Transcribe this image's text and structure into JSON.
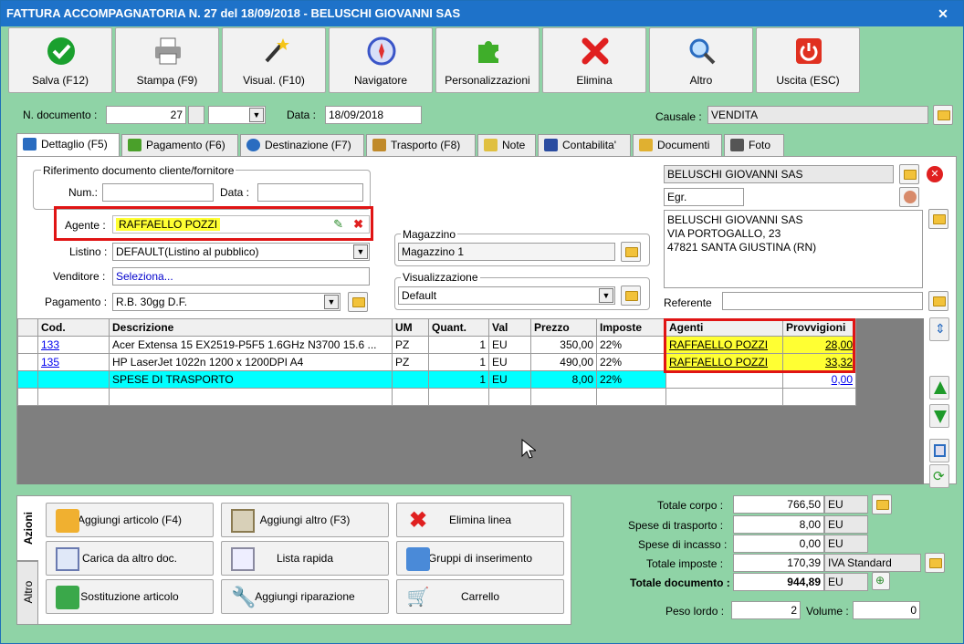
{
  "window": {
    "title": "FATTURA ACCOMPAGNATORIA N. 27 del 18/09/2018 - BELUSCHI GIOVANNI SAS"
  },
  "toolbar": [
    {
      "label": "Salva (F12)",
      "icon": "check-icon",
      "color": "#1aa02e"
    },
    {
      "label": "Stampa (F9)",
      "icon": "printer-icon",
      "color": "#8a8a8a"
    },
    {
      "label": "Visual. (F10)",
      "icon": "magic-wand-icon",
      "color": "#333333"
    },
    {
      "label": "Navigatore",
      "icon": "compass-icon",
      "color": "#3a55c8"
    },
    {
      "label": "Personalizzazioni",
      "icon": "puzzle-icon",
      "color": "#3fae2a"
    },
    {
      "label": "Elimina",
      "icon": "red-x-icon",
      "color": "#e02020"
    },
    {
      "label": "Altro",
      "icon": "magnifier-icon",
      "color": "#2a6cc0"
    },
    {
      "label": "Uscita (ESC)",
      "icon": "power-icon",
      "color": "#e03020"
    }
  ],
  "header": {
    "doc_label": "N. documento :",
    "doc_number": "27",
    "date_label": "Data :",
    "date": "18/09/2018",
    "causale_label": "Causale :",
    "causale": "VENDITA"
  },
  "tabs": [
    {
      "label": "Dettaglio (F5)",
      "color": "#2a6cc0"
    },
    {
      "label": "Pagamento (F6)",
      "color": "#4aa02a"
    },
    {
      "label": "Destinazione (F7)",
      "color": "#2a6cc0"
    },
    {
      "label": "Trasporto (F8)",
      "color": "#c08a2a"
    },
    {
      "label": "Note",
      "color": "#e0c040"
    },
    {
      "label": "Contabilita'",
      "color": "#2a4ca0"
    },
    {
      "label": "Documenti",
      "color": "#e0b030"
    },
    {
      "label": "Foto",
      "color": "#555555"
    }
  ],
  "riferimento": {
    "title": "Riferimento documento cliente/fornitore",
    "num_label": "Num.:",
    "data_label": "Data :"
  },
  "form": {
    "agente_label": "Agente :",
    "agente": "RAFFAELLO POZZI",
    "listino_label": "Listino :",
    "listino": "DEFAULT(Listino al pubblico)",
    "venditore_label": "Venditore :",
    "venditore": "Seleziona...",
    "pagamento_label": "Pagamento :",
    "pagamento": "R.B. 30gg D.F.",
    "magazzino_title": "Magazzino",
    "magazzino": "Magazzino 1",
    "visual_title": "Visualizzazione",
    "visual": "Default"
  },
  "cliente": {
    "name": "BELUSCHI GIOVANNI SAS",
    "title": "Egr.",
    "address": [
      "BELUSCHI GIOVANNI SAS",
      "VIA PORTOGALLO, 23",
      "47821 SANTA GIUSTINA (RN)"
    ],
    "referente_label": "Referente"
  },
  "grid": {
    "headers": [
      "Cod.",
      "Descrizione",
      "UM",
      "Quant.",
      "Val",
      "Prezzo",
      "Imposte",
      "Agenti",
      "Provvigioni"
    ],
    "rows": [
      {
        "cod": "133",
        "desc": "Acer Extensa 15 EX2519-P5F5 1.6GHz N3700 15.6 ...",
        "um": "PZ",
        "qty": "1",
        "val": "EU",
        "price": "350,00",
        "tax": "22%",
        "agent": "RAFFAELLO POZZI",
        "comm": "28,00"
      },
      {
        "cod": "135",
        "desc": "HP LaserJet 1022n 1200 x 1200DPI A4",
        "um": "PZ",
        "qty": "1",
        "val": "EU",
        "price": "490,00",
        "tax": "22%",
        "agent": "RAFFAELLO POZZI",
        "comm": "33,32"
      },
      {
        "cod": "",
        "desc": "SPESE DI TRASPORTO",
        "um": "",
        "qty": "1",
        "val": "EU",
        "price": "8,00",
        "tax": "22%",
        "agent": "",
        "comm": "0,00"
      }
    ]
  },
  "actions": {
    "side_tabs": [
      "Azioni",
      "Altro"
    ],
    "buttons": [
      {
        "label": "Aggiungi articolo (F4)",
        "icon": "add-article-icon"
      },
      {
        "label": "Aggiungi altro (F3)",
        "icon": "add-other-icon"
      },
      {
        "label": "Elimina linea",
        "icon": "delete-line-icon"
      },
      {
        "label": "Carica da altro doc.",
        "icon": "load-doc-icon"
      },
      {
        "label": "Lista rapida",
        "icon": "quick-list-icon"
      },
      {
        "label": "Gruppi di inserimento",
        "icon": "insert-groups-icon"
      },
      {
        "label": "Sostituzione articolo",
        "icon": "replace-article-icon"
      },
      {
        "label": "Aggiungi riparazione",
        "icon": "wrench-icon"
      },
      {
        "label": "Carrello",
        "icon": "cart-icon"
      }
    ]
  },
  "totals": {
    "corpo_label": "Totale corpo :",
    "corpo": "766,50",
    "corpo_cur": "EU",
    "trasporto_label": "Spese di trasporto :",
    "trasporto": "8,00",
    "trasporto_cur": "EU",
    "incasso_label": "Spese di incasso :",
    "incasso": "0,00",
    "incasso_cur": "EU",
    "imposte_label": "Totale imposte :",
    "imposte": "170,39",
    "imposte_note": "IVA Standard",
    "documento_label": "Totale documento :",
    "documento": "944,89",
    "documento_cur": "EU",
    "peso_label": "Peso lordo :",
    "peso": "2",
    "volume_label": "Volume :",
    "volume": "0"
  }
}
